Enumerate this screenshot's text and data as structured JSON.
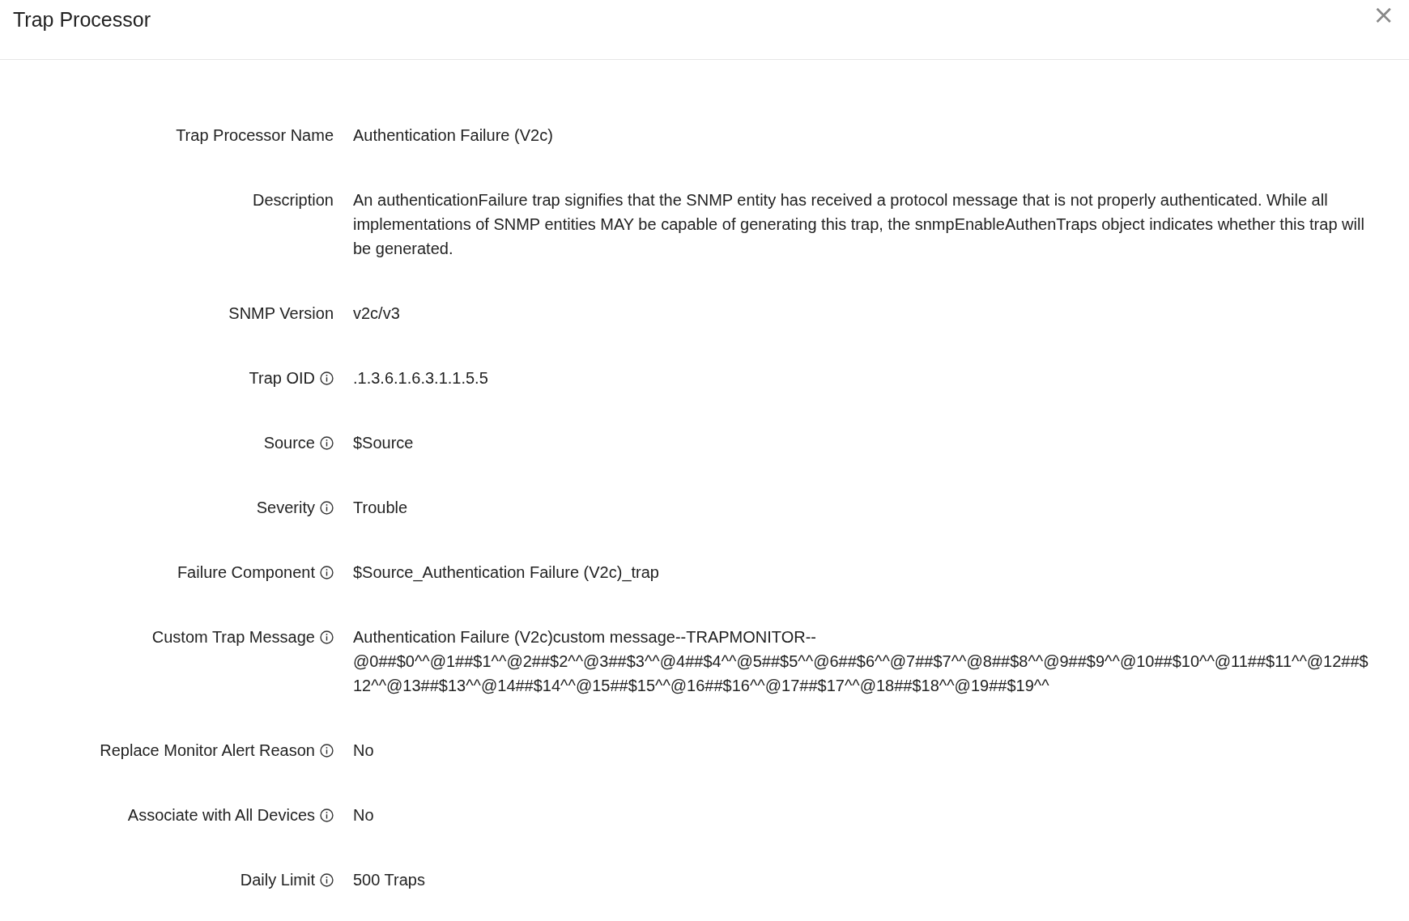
{
  "window": {
    "title": "Trap Processor",
    "close": "×"
  },
  "fields": [
    {
      "label": "Trap Processor Name",
      "info": false,
      "lines": [
        "Authentication Failure (V2c)"
      ]
    },
    {
      "label": "Description",
      "info": false,
      "lines": [
        "An authenticationFailure trap signifies that the SNMP entity has received a protocol message that is not properly authenticated. While all implementations of SNMP entities MAY be capable of generating this trap, the snmpEnableAuthenTraps object indicates whether this trap will be generated."
      ]
    },
    {
      "label": "SNMP Version",
      "info": false,
      "lines": [
        "v2c/v3"
      ]
    },
    {
      "label": "Trap OID",
      "info": true,
      "lines": [
        ".1.3.6.1.6.3.1.1.5.5"
      ]
    },
    {
      "label": "Source",
      "info": true,
      "lines": [
        "$Source"
      ]
    },
    {
      "label": "Severity",
      "info": true,
      "lines": [
        "Trouble"
      ]
    },
    {
      "label": "Failure Component",
      "info": true,
      "lines": [
        "$Source_Authentication Failure (V2c)_trap"
      ]
    },
    {
      "label": "Custom Trap Message",
      "info": true,
      "lines": [
        "Authentication Failure (V2c)custom message--TRAPMONITOR--",
        "@0##$0^^@1##$1^^@2##$2^^@3##$3^^@4##$4^^@5##$5^^@6##$6^^@7##$7^^@8##$8^^@9##$9^^@10##$10^^@11##$11^^@12##$",
        "12^^@13##$13^^@14##$14^^@15##$15^^@16##$16^^@17##$17^^@18##$18^^@19##$19^^"
      ]
    },
    {
      "label": "Replace Monitor Alert Reason",
      "info": true,
      "lines": [
        "No"
      ]
    },
    {
      "label": "Associate with All Devices",
      "info": true,
      "lines": [
        "No"
      ]
    },
    {
      "label": "Daily Limit",
      "info": true,
      "lines": [
        "500 Traps"
      ]
    }
  ]
}
